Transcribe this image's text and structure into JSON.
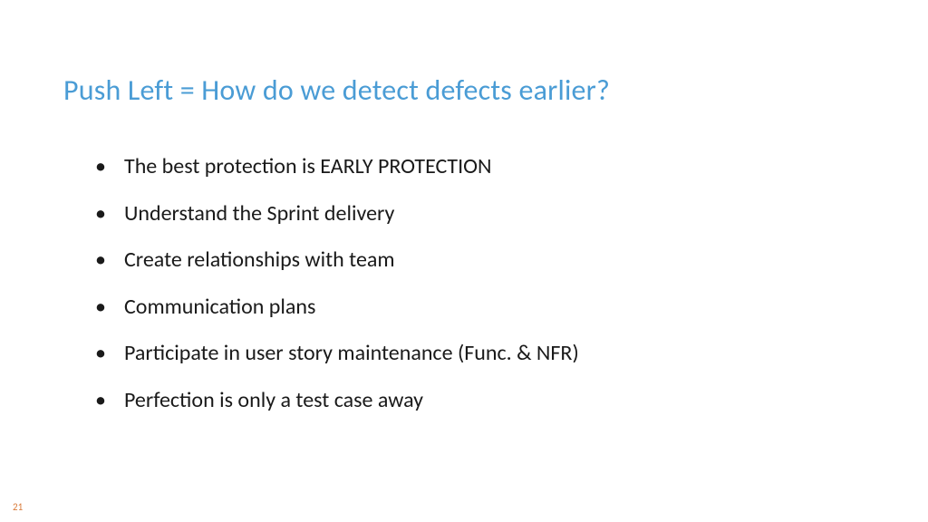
{
  "slide": {
    "title": "Push Left = How do we detect defects earlier?",
    "bullets": [
      "The best protection is EARLY PROTECTION",
      "Understand the Sprint delivery",
      "Create relationships with team",
      "Communication plans",
      "Participate in user story maintenance (Func. & NFR)",
      "Perfection is only a test case away"
    ],
    "page_number": "21"
  }
}
